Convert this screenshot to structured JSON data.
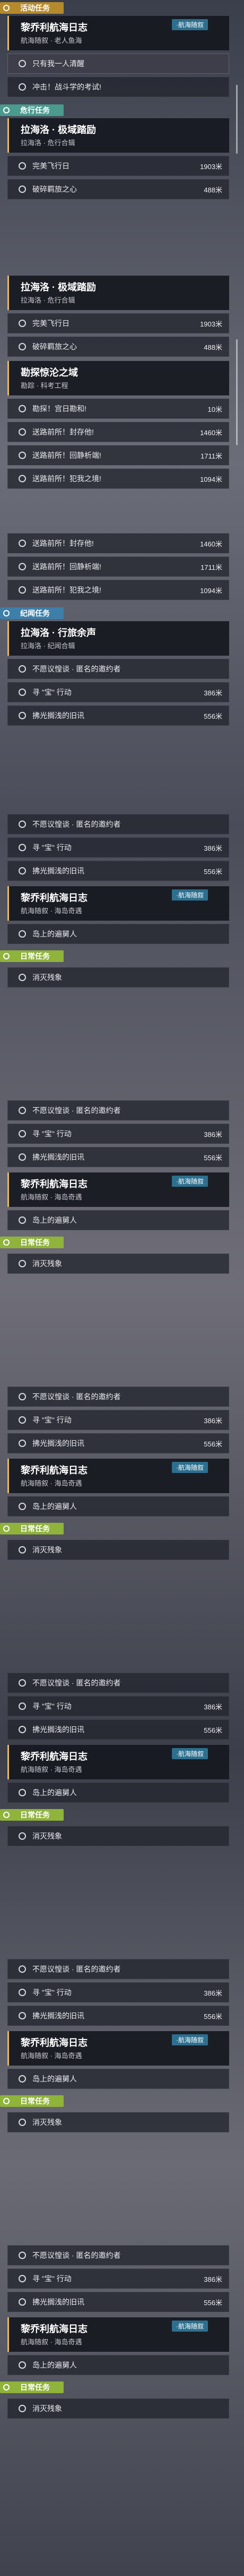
{
  "colors": {
    "event": "#b48a2c",
    "story": "#4a9a8e",
    "world": "#3d7fa8",
    "daily": "#8fb33b",
    "accent": "#e7b86a"
  },
  "p1": {
    "tag": "活动任务",
    "card": {
      "title": "黎乔利航海日志",
      "sub": "航海随叙 · 老人鱼海",
      "badge": "·航海随叙"
    },
    "items": [
      {
        "txt": "只有我一人清醒",
        "dist": ""
      },
      {
        "txt": "冲击！战斗学的考试!",
        "dist": ""
      }
    ]
  },
  "p2": {
    "tag": "危行任务",
    "card": {
      "title": "拉海洛 · 极域踏励",
      "sub": "拉海洛 · 危行合辑"
    },
    "items": [
      {
        "txt": "完美飞行日",
        "dist": "1903米"
      },
      {
        "txt": "破碎羁旅之心",
        "dist": "488米"
      }
    ]
  },
  "p3": {
    "card": {
      "title": "拉海洛 · 极域踏励",
      "sub": "拉海洛 · 危行合辑"
    },
    "items": [
      {
        "txt": "完美飞行日",
        "dist": "1903米"
      },
      {
        "txt": "破碎羁旅之心",
        "dist": "488米"
      }
    ],
    "card2": {
      "title": "勘探惊沦之域",
      "sub": "勘踪 · 科考工程"
    },
    "items2": [
      {
        "txt": "勘探！宫日勘和!",
        "dist": "10米"
      },
      {
        "txt": "送路前所！封存他!",
        "dist": "1460米"
      },
      {
        "txt": "送路前所！回静析端!",
        "dist": "1711米"
      },
      {
        "txt": "送路前所！犯我之境!",
        "dist": "1094米"
      }
    ]
  },
  "p4": {
    "items": [
      {
        "txt": "送路前所！封存他!",
        "dist": "1460米"
      },
      {
        "txt": "送路前所！回静析端!",
        "dist": "1711米"
      },
      {
        "txt": "送路前所！犯我之境!",
        "dist": "1094米"
      }
    ],
    "tag": "纪闻任务",
    "card": {
      "title": "拉海洛 · 行旅余声",
      "sub": "拉海洛 · 纪闻合辑"
    },
    "items2": [
      {
        "txt": "不愿议惶谈 · 匿名的邀约者",
        "dist": ""
      },
      {
        "txt": "寻 \"宝\" 行动",
        "dist": "386米"
      },
      {
        "txt": "拂光搁浅的旧讯",
        "dist": "556米"
      }
    ]
  },
  "repeat": {
    "card_top": {
      "title": "拉海洛 · 行旅余声",
      "sub": "拉海洛 · 纪闻合辑"
    },
    "items": [
      {
        "txt": "不愿议惶谈 · 匿名的邀约者",
        "dist": ""
      },
      {
        "txt": "寻 \"宝\" 行动",
        "dist": "386米"
      },
      {
        "txt": "拂光搁浅的旧讯",
        "dist": "556米"
      }
    ],
    "card": {
      "title": "黎乔利航海日志",
      "sub": "航海随叙 · 海岛奇遇",
      "badge": "·航海随叙"
    },
    "item_sea": {
      "txt": "岛上的遍舅人",
      "dist": ""
    },
    "tag_daily": "日常任务",
    "item_daily": {
      "txt": "消灭残象",
      "dist": ""
    }
  }
}
